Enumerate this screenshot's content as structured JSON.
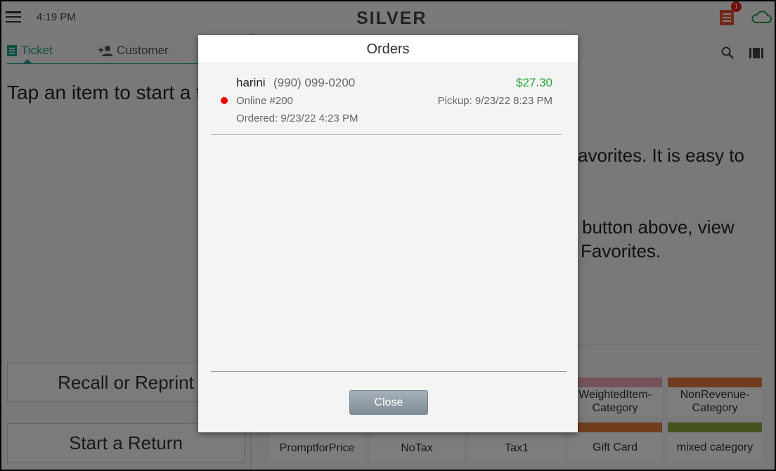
{
  "topbar": {
    "time": "4:19 PM",
    "logo": "SILVER",
    "notification_count": "1",
    "cloud_color": "#1c9a4a",
    "receipt_color": "#e0552e"
  },
  "left": {
    "tabs": [
      {
        "label": "Ticket",
        "icon": "ticket-icon",
        "active": true
      },
      {
        "label": "Customer",
        "icon": "add-person-icon"
      }
    ],
    "message": "Tap an item to start a ticket",
    "recall_label": "Recall or Reprint",
    "return_label": "Start a Return"
  },
  "right": {
    "line1": "avorites. It is easy to",
    "line2": "button above, view",
    "line3": "Favorites.",
    "categories": [
      {
        "label": "WeightedItem-Category",
        "color": "#e8a5b5"
      },
      {
        "label": "NonRevenue-Category",
        "color": "#e07a3a"
      },
      {
        "label": "PromptforPrice",
        "color": ""
      },
      {
        "label": "NoTax",
        "color": ""
      },
      {
        "label": "Tax1",
        "color": ""
      },
      {
        "label": "Gift Card",
        "color": "#e07a3a"
      },
      {
        "label": "mixed category",
        "color": "#8aa53a"
      }
    ]
  },
  "modal": {
    "title": "Orders",
    "orders": [
      {
        "name": "harini",
        "phone": "(990) 099-0200",
        "amount": "$27.30",
        "source": "Online #200",
        "pickup": "Pickup: 9/23/22 8:23 PM",
        "ordered": "Ordered: 9/23/22 4:23 PM",
        "status_color": "#e00000"
      }
    ],
    "close_label": "Close"
  }
}
